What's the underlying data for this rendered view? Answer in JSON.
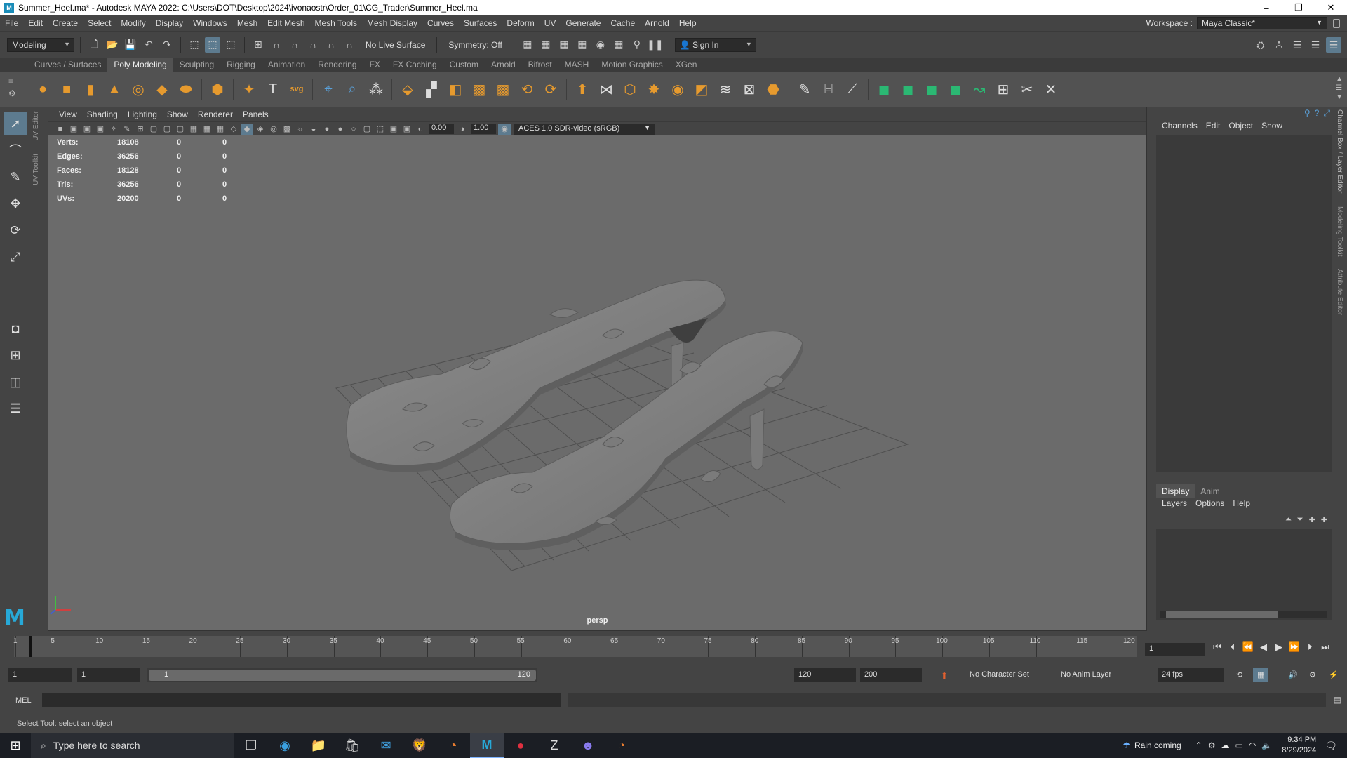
{
  "window": {
    "title": "Summer_Heel.ma* - Autodesk MAYA 2022: C:\\Users\\DOT\\Desktop\\2024\\ivonaostr\\Order_01\\CG_Trader\\Summer_Heel.ma",
    "minimize": "–",
    "restore": "❐",
    "close": "✕"
  },
  "menubar": {
    "items": [
      "File",
      "Edit",
      "Create",
      "Select",
      "Modify",
      "Display",
      "Windows",
      "Mesh",
      "Edit Mesh",
      "Mesh Tools",
      "Mesh Display",
      "Curves",
      "Surfaces",
      "Deform",
      "UV",
      "Generate",
      "Cache",
      "Arnold",
      "Help"
    ],
    "workspace_label": "Workspace :",
    "workspace_value": "Maya Classic*"
  },
  "statusline": {
    "mode": "Modeling",
    "live_surface": "No Live Surface",
    "symmetry": "Symmetry: Off",
    "sign_in": "Sign In"
  },
  "shelf": {
    "tabs": [
      "Curves / Surfaces",
      "Poly Modeling",
      "Sculpting",
      "Rigging",
      "Animation",
      "Rendering",
      "FX",
      "FX Caching",
      "Custom",
      "Arnold",
      "Bifrost",
      "MASH",
      "Motion Graphics",
      "XGen"
    ],
    "active_tab": "Poly Modeling"
  },
  "side_tabs": [
    "UV Editor",
    "UV Toolkit"
  ],
  "right_tabs": [
    "Channel Box / Layer Editor",
    "Modeling Toolkit",
    "Attribute Editor"
  ],
  "viewport": {
    "menus": [
      "View",
      "Shading",
      "Lighting",
      "Show",
      "Renderer",
      "Panels"
    ],
    "exposure": "0.00",
    "gamma": "1.00",
    "color_space": "ACES 1.0 SDR-video (sRGB)",
    "camera": "persp",
    "hud": [
      {
        "label": "Verts:",
        "value": "18108",
        "sel": "0",
        "comp": "0"
      },
      {
        "label": "Edges:",
        "value": "36256",
        "sel": "0",
        "comp": "0"
      },
      {
        "label": "Faces:",
        "value": "18128",
        "sel": "0",
        "comp": "0"
      },
      {
        "label": "Tris:",
        "value": "36256",
        "sel": "0",
        "comp": "0"
      },
      {
        "label": "UVs:",
        "value": "20200",
        "sel": "0",
        "comp": "0"
      }
    ]
  },
  "channel_box": {
    "menus": [
      "Channels",
      "Edit",
      "Object",
      "Show"
    ],
    "layer_tabs": [
      "Display",
      "Anim"
    ],
    "layer_menus": [
      "Layers",
      "Options",
      "Help"
    ]
  },
  "timeline": {
    "ticks": [
      "1",
      "5",
      "10",
      "15",
      "20",
      "25",
      "30",
      "35",
      "40",
      "45",
      "50",
      "55",
      "60",
      "65",
      "70",
      "75",
      "80",
      "85",
      "90",
      "95",
      "100",
      "105",
      "110",
      "115",
      "120"
    ],
    "current_frame": "1"
  },
  "range": {
    "start": "1",
    "range_start": "1",
    "handle_start": "1",
    "handle_end": "120",
    "range_end": "120",
    "end": "200",
    "character_set": "No Character Set",
    "anim_layer": "No Anim Layer",
    "fps": "24 fps"
  },
  "command": {
    "mel_label": "MEL",
    "help_text": "Select Tool: select an object"
  },
  "taskbar": {
    "search_placeholder": "Type here to search",
    "weather": "Rain coming",
    "time": "9:34 PM",
    "date": "8/29/2024"
  },
  "colors": {
    "accent": "#5d7b8f",
    "maya_blue": "#27a9d8",
    "shelf_orange": "#e69a2e"
  }
}
